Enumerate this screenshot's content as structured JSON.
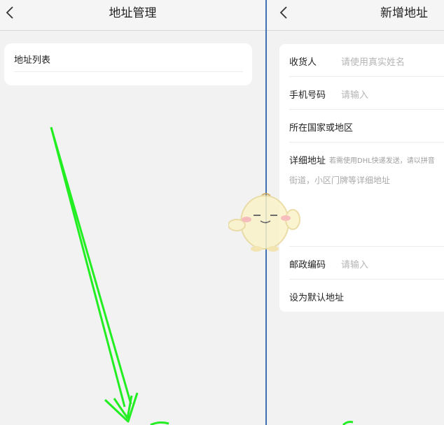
{
  "left_screen": {
    "back_icon": "chevron-left-icon",
    "title": "地址管理",
    "address_list": {
      "title": "地址列表"
    }
  },
  "right_screen": {
    "back_icon": "chevron-left-icon",
    "title": "新增地址",
    "form": {
      "recipient": {
        "label": "收货人",
        "placeholder": "请使用真实姓名"
      },
      "phone": {
        "label": "手机号码",
        "placeholder": "请输入"
      },
      "region": {
        "label": "所在国家或地区"
      },
      "detail": {
        "label": "详细地址",
        "hint": "若需使用DHL快递发送，请以拼音",
        "placeholder": "街道，小区门牌等详细地址"
      },
      "postcode": {
        "label": "邮政编码",
        "placeholder": "请输入"
      },
      "default": {
        "label": "设为默认地址"
      }
    }
  },
  "colors": {
    "annotation_arrow": "#22ee22",
    "divider_blue": "#3f6fb5"
  },
  "overlays": {
    "mascot": "chick-mascot-watermark",
    "annotation": "green-arrows"
  }
}
